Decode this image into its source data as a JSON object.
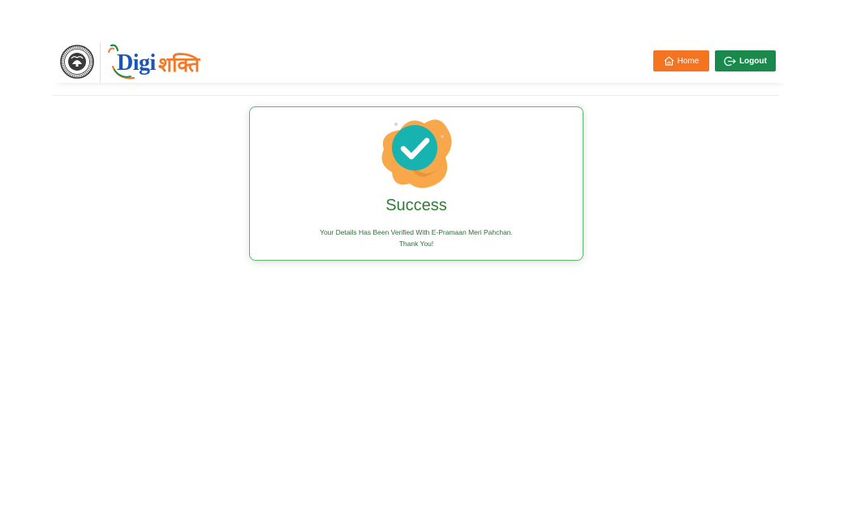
{
  "header": {
    "brand": {
      "latin": "Digi",
      "devanagari": "शक्ति"
    },
    "home_button": {
      "label": "Home",
      "icon": "home-icon",
      "color": "#f47421"
    },
    "logout_button": {
      "label": "Logout",
      "icon": "logout-icon",
      "color": "#1a8a4c"
    }
  },
  "card": {
    "icon": "check-circle-icon",
    "title": "Success",
    "message_line1": "Your Details Has Been Verified With E-Pramaan Meri Pahchan.",
    "message_line2": "Thank You!",
    "border_color": "#5aba68",
    "title_color": "#2e7d32",
    "check_color": "#17b3b1",
    "blob_color": "#f9a74b"
  }
}
